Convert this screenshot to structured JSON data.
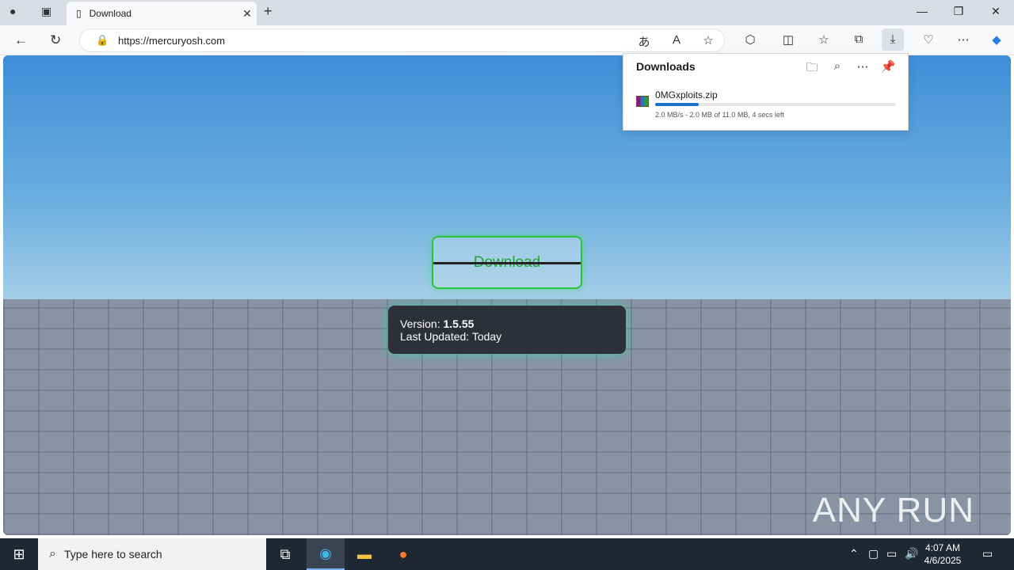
{
  "browser": {
    "tab_title": "Download",
    "url": "https://mercuryosh.com"
  },
  "downloads_panel": {
    "title": "Downloads",
    "file_name": "0MGxploits.zip",
    "progress_fraction": 0.18,
    "status": "2.0 MB/s - 2.0 MB of 11.0 MB, 4 secs left"
  },
  "page": {
    "download_button": "Download",
    "version_label": "Version:",
    "version_value": "1.5.55",
    "updated_label": "Last Updated:",
    "updated_value": "Today",
    "watermark": "ANY RUN"
  },
  "taskbar": {
    "search_placeholder": "Type here to search",
    "time": "4:07 AM",
    "date": "4/6/2025"
  },
  "icons": [
    "profile-icon",
    "tab-actions-icon",
    "new-tab-icon",
    "minimize-icon",
    "restore-icon",
    "close-window-icon",
    "back-icon",
    "refresh-icon",
    "lock-icon",
    "translate-icon",
    "read-aloud-icon",
    "favorite-star-icon",
    "extensions-icon",
    "split-screen-icon",
    "favorites-icon",
    "collections-icon",
    "downloads-icon",
    "browser-essentials-icon",
    "more-icon",
    "copilot-icon",
    "folder-icon",
    "search-icon",
    "pin-icon",
    "windows-start-icon",
    "task-view-icon",
    "edge-icon",
    "file-explorer-icon",
    "firefox-icon"
  ]
}
